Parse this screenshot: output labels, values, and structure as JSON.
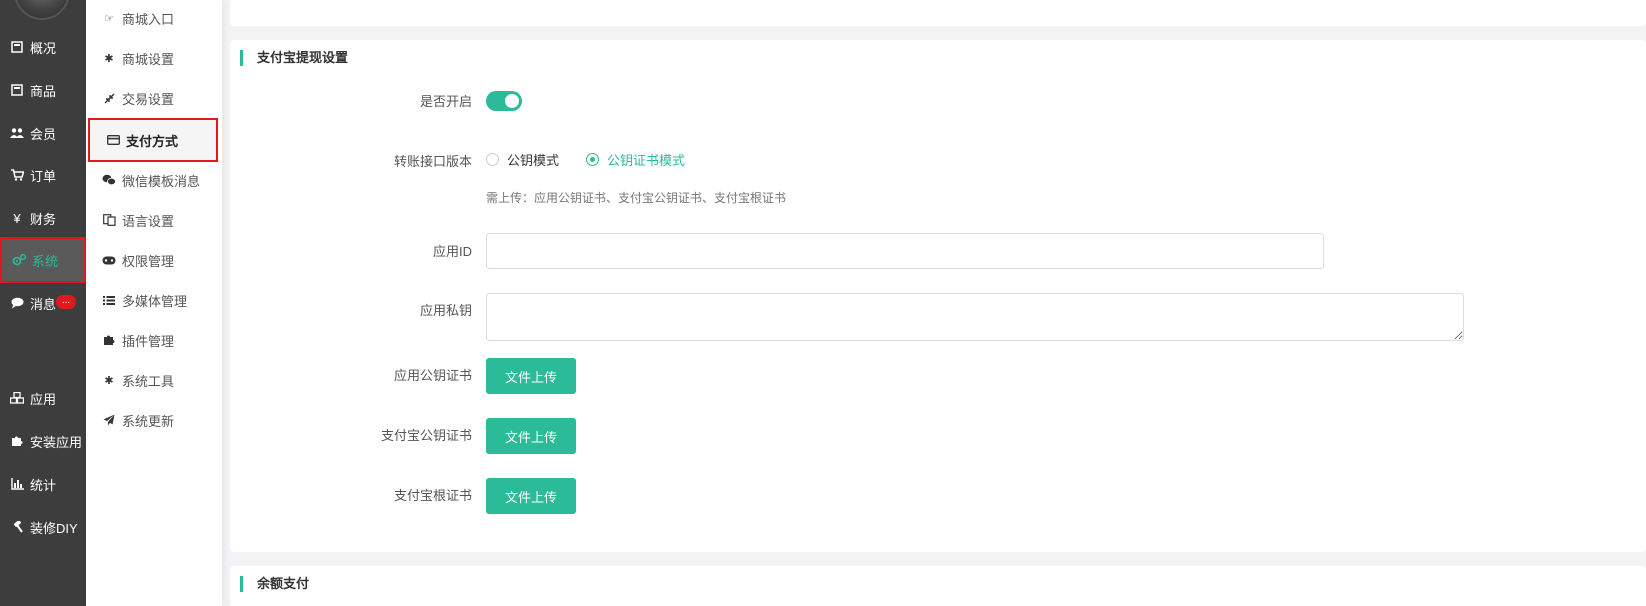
{
  "main_nav": {
    "items": [
      {
        "label": "概况",
        "icon": "overview-icon"
      },
      {
        "label": "商品",
        "icon": "goods-icon"
      },
      {
        "label": "会员",
        "icon": "users-icon"
      },
      {
        "label": "订单",
        "icon": "cart-icon"
      },
      {
        "label": "财务",
        "icon": "yen-icon"
      },
      {
        "label": "系统",
        "icon": "gears-icon"
      },
      {
        "label": "消息",
        "icon": "comment-icon"
      },
      {
        "label": "应用",
        "icon": "cubes-icon"
      },
      {
        "label": "安装应用",
        "icon": "puzzle-icon"
      },
      {
        "label": "统计",
        "icon": "bar-chart-icon"
      },
      {
        "label": "装修DIY",
        "icon": "hammer-icon"
      }
    ],
    "message_badge": "...",
    "active_item": "系统"
  },
  "sub_nav": {
    "items": [
      {
        "label": "商城入口",
        "icon": "hand-point-icon"
      },
      {
        "label": "商城设置",
        "icon": "gear-icon"
      },
      {
        "label": "交易设置",
        "icon": "compress-icon"
      },
      {
        "label": "支付方式",
        "icon": "credit-card-icon"
      },
      {
        "label": "微信模板消息",
        "icon": "wechat-icon"
      },
      {
        "label": "语言设置",
        "icon": "language-icon"
      },
      {
        "label": "权限管理",
        "icon": "gamepad-icon"
      },
      {
        "label": "多媒体管理",
        "icon": "list-icon"
      },
      {
        "label": "插件管理",
        "icon": "puzzle-icon"
      },
      {
        "label": "系统工具",
        "icon": "gear-icon"
      },
      {
        "label": "系统更新",
        "icon": "paper-plane-icon"
      }
    ],
    "active_item": "支付方式"
  },
  "alipay_section": {
    "title": "支付宝提现设置",
    "enable_label": "是否开启",
    "enable_state": "on",
    "version_label": "转账接口版本",
    "version_options": [
      "公钥模式",
      "公钥证书模式"
    ],
    "version_selected": "公钥证书模式",
    "hint": "需上传：应用公钥证书、支付宝公钥证书、支付宝根证书",
    "app_id_label": "应用ID",
    "app_id_value": "",
    "private_key_label": "应用私钥",
    "private_key_value": "",
    "app_cert_label": "应用公钥证书",
    "alipay_cert_label": "支付宝公钥证书",
    "root_cert_label": "支付宝根证书",
    "upload_label": "文件上传"
  },
  "balance_section": {
    "title": "余额支付"
  },
  "colors": {
    "accent": "#2bbb98",
    "sidebar_bg": "#3d3d3d",
    "highlight_border": "#e0191f"
  }
}
